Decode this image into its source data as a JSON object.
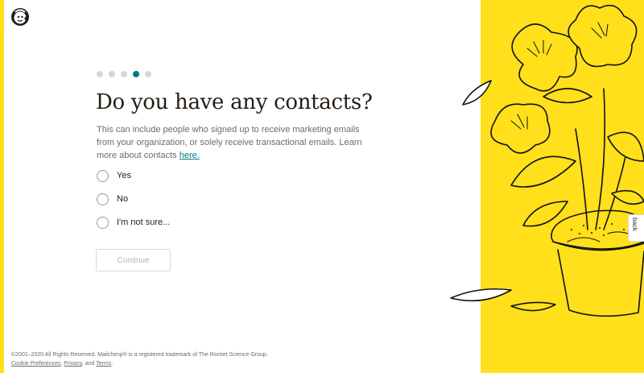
{
  "brand": {
    "logo_icon": "mailchimp-freddie-icon",
    "accent": "#ffe01b",
    "teal": "#007c89"
  },
  "progress": {
    "total_steps": 5,
    "current_step": 4
  },
  "main": {
    "title": "Do you have any contacts?",
    "description": "This can include people who signed up to receive marketing emails from your organization, or solely receive transactional emails. Learn more about contacts",
    "link_text": "here."
  },
  "options": [
    {
      "label": "Yes"
    },
    {
      "label": "No"
    },
    {
      "label": "I'm not sure..."
    }
  ],
  "continue_label": "Continue",
  "feedback_label": "back",
  "footer": {
    "copyright": "©2001–2020 All Rights Reserved. Mailchimp® is a registered trademark of The Rocket Science Group.",
    "cookie_link": "Cookie Preferences",
    "privacy_link": "Privacy",
    "and_text": ", and",
    "terms_link": "Terms"
  }
}
